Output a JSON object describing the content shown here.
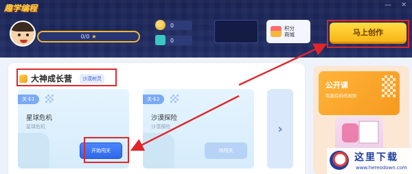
{
  "app": {
    "logo_text": "趣学编程"
  },
  "window_controls": {
    "minimize": "—",
    "close": "✕"
  },
  "profile": {
    "xp": "0/0",
    "star": "★"
  },
  "stats": {
    "coins": "0",
    "gems": "0"
  },
  "shop": {
    "label": "积分商城"
  },
  "create_button": {
    "label": "马上创作"
  },
  "section": {
    "title": "大神成长营",
    "badge": "沙漠树灵"
  },
  "levels": [
    {
      "tag": "关卡1",
      "name": "星球危机",
      "subtitle": "星球危机",
      "action": "开始闯关",
      "state": "primary"
    },
    {
      "tag": "关卡2",
      "name": "沙漠探险",
      "subtitle": "沙漠探险",
      "action": "待闯关",
      "state": "pending"
    }
  ],
  "next_arrow": "›",
  "promo": {
    "title": "公开课",
    "subtitle": "有趣有料的视频"
  },
  "watermark": {
    "name": "这里下载",
    "url": "www.hereodown.com"
  },
  "colors": {
    "accent_red": "#e0262b",
    "create_yellow": "#f7b519",
    "topbar_navy": "#1a2352",
    "primary_blue": "#2f67e8"
  }
}
